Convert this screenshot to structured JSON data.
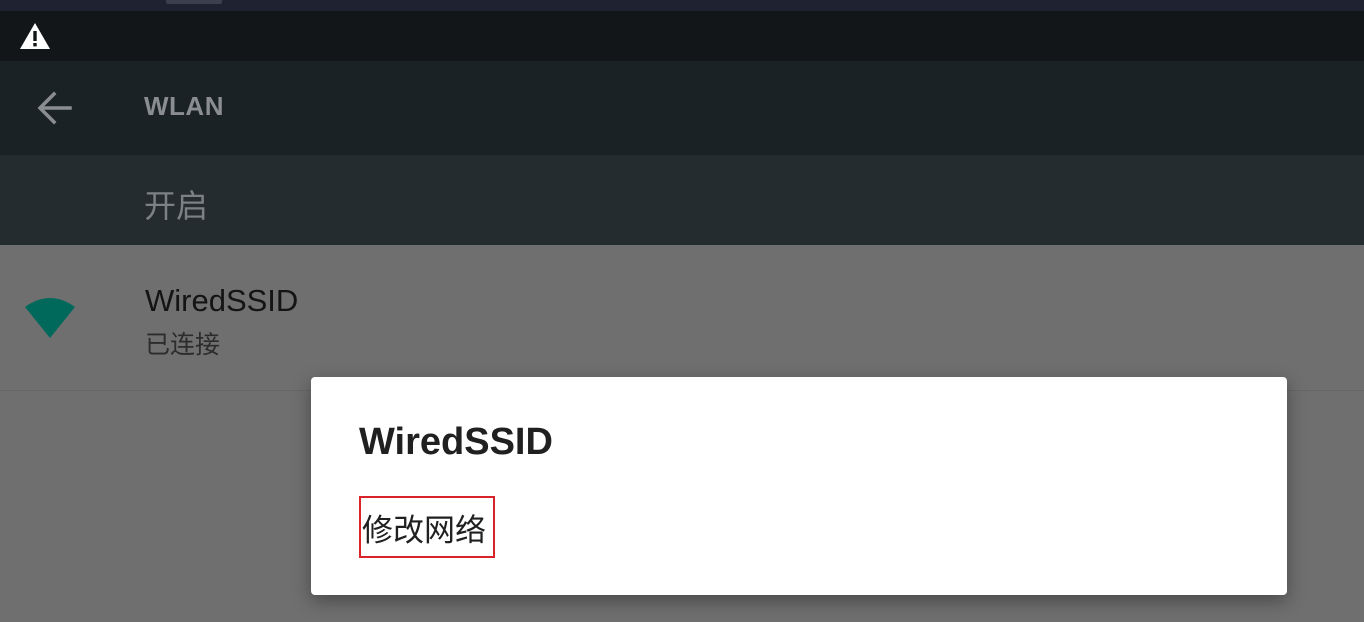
{
  "status_bar": {
    "icons": [
      "warning-icon"
    ]
  },
  "app_bar": {
    "back_icon": "arrow-left-icon",
    "title": "WLAN"
  },
  "wifi_switch": {
    "label": "开启"
  },
  "networks": [
    {
      "icon": "wifi-signal-icon",
      "name": "WiredSSID",
      "status": "已连接"
    }
  ],
  "dialog": {
    "title": "WiredSSID",
    "options": [
      {
        "label": "修改网络"
      }
    ]
  },
  "colors": {
    "accent_teal": "#00695c",
    "highlight_border": "#d8232a"
  }
}
